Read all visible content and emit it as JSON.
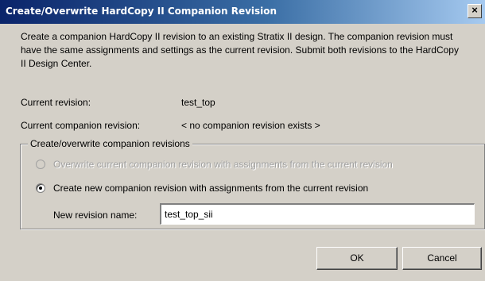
{
  "window": {
    "title": "Create/Overwrite HardCopy II Companion Revision",
    "close_label": "×"
  },
  "description": "Create a companion HardCopy II revision to an existing Stratix II design. The companion revision must have the same assignments and settings as the current revision. Submit both revisions to the HardCopy II Design Center.",
  "info": {
    "current_revision_label": "Current revision:",
    "current_revision_value": "test_top",
    "companion_revision_label": "Current companion revision:",
    "companion_revision_value": "< no companion revision exists >"
  },
  "group": {
    "legend": "Create/overwrite companion revisions",
    "options": [
      {
        "label": "Overwrite current companion revision with assignments from the current revision",
        "selected": false,
        "enabled": false
      },
      {
        "label": "Create new companion revision with assignments from the current revision",
        "selected": true,
        "enabled": true
      }
    ],
    "name_label": "New revision name:",
    "name_value": "test_top_sii"
  },
  "buttons": {
    "ok": "OK",
    "cancel": "Cancel"
  }
}
